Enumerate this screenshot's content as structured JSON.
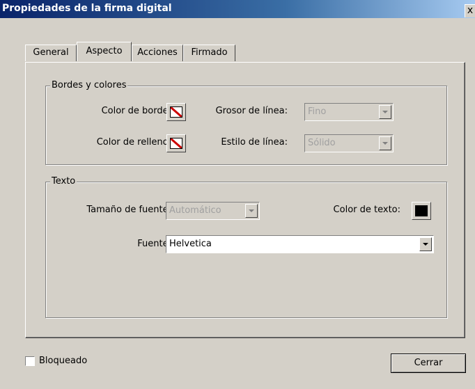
{
  "window": {
    "title": "Propiedades de la firma digital",
    "close_glyph": "x"
  },
  "tabs": [
    {
      "label": "General",
      "active": false
    },
    {
      "label": "Aspecto",
      "active": true
    },
    {
      "label": "Acciones",
      "active": false
    },
    {
      "label": "Firmado",
      "active": false
    }
  ],
  "borders_group": {
    "legend": "Bordes y colores",
    "border_color_label": "Color de borde:",
    "fill_color_label": "Color de relleno:",
    "line_width_label": "Grosor de línea:",
    "line_width_value": "Fino",
    "line_style_label": "Estilo de línea:",
    "line_style_value": "Sólido",
    "swatch_icon": "no-color-icon",
    "swatch_slash_color": "#cc0000"
  },
  "text_group": {
    "legend": "Texto",
    "font_size_label": "Tamaño de fuente:",
    "font_size_value": "Automático",
    "text_color_label": "Color de texto:",
    "text_color": "#000000",
    "font_label": "Fuente:",
    "font_value": "Helvetica"
  },
  "locked": {
    "label": "Bloqueado",
    "checked": false
  },
  "close_button": {
    "label": "Cerrar"
  }
}
